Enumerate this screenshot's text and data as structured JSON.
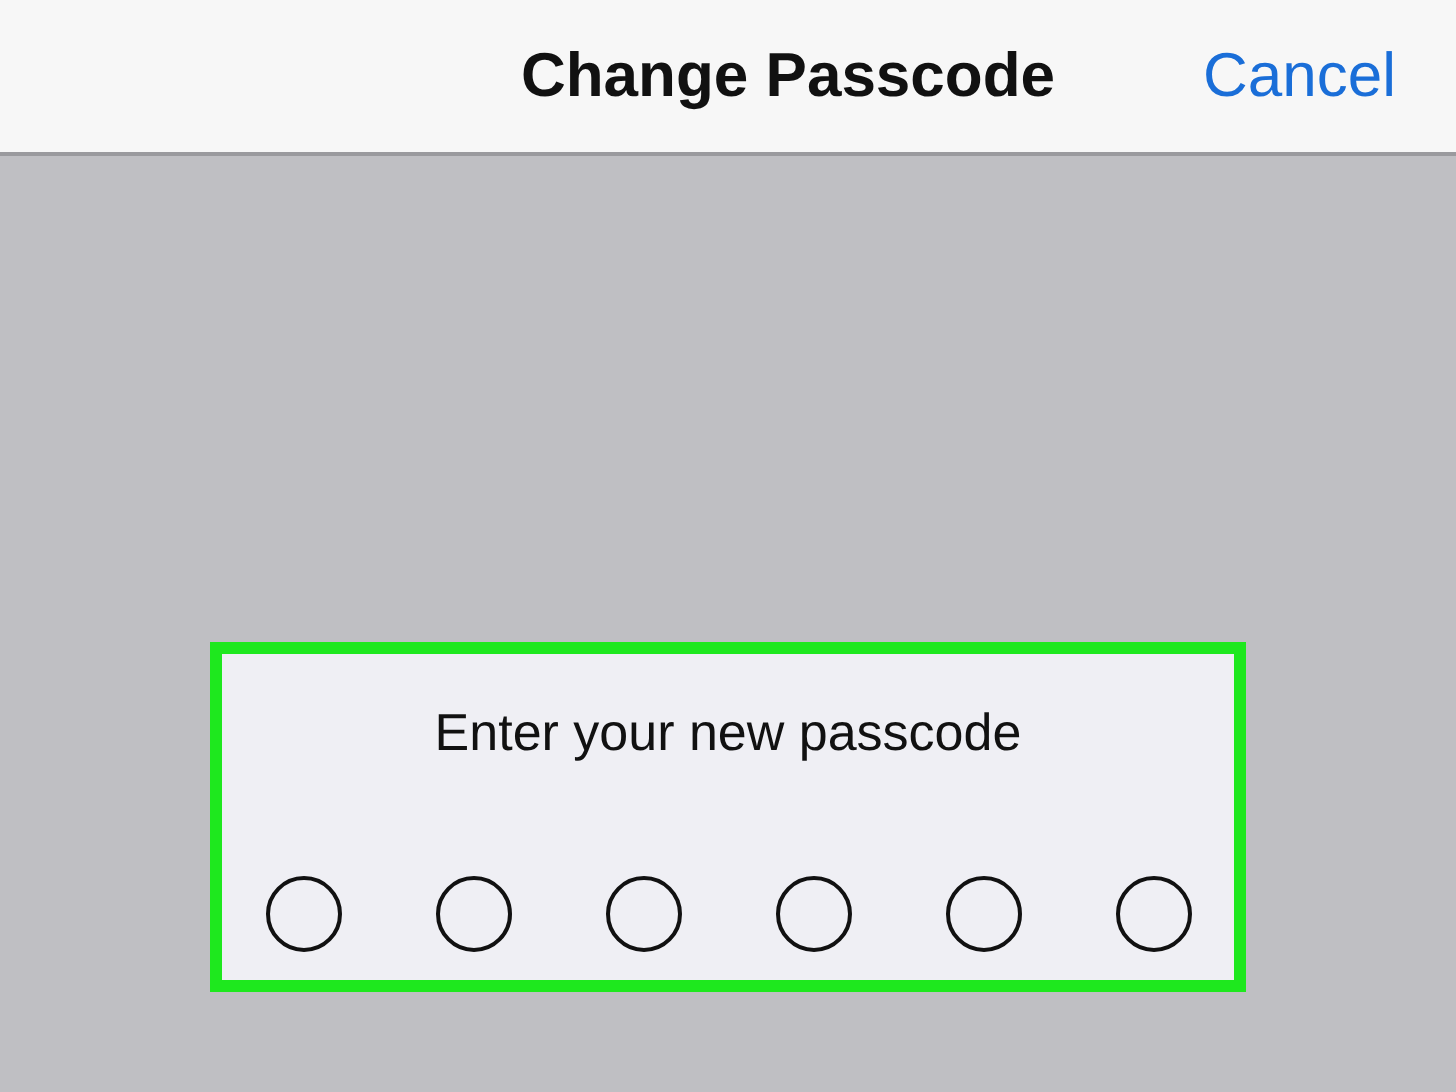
{
  "nav_bar": {
    "title": "Change Passcode",
    "cancel": "Cancel"
  },
  "passcode_panel": {
    "highlighted": true,
    "prompt": "Enter your new passcode",
    "digits": [
      {
        "filled": false
      },
      {
        "filled": false
      },
      {
        "filled": false
      },
      {
        "filled": false
      },
      {
        "filled": false
      },
      {
        "filled": false
      }
    ]
  }
}
